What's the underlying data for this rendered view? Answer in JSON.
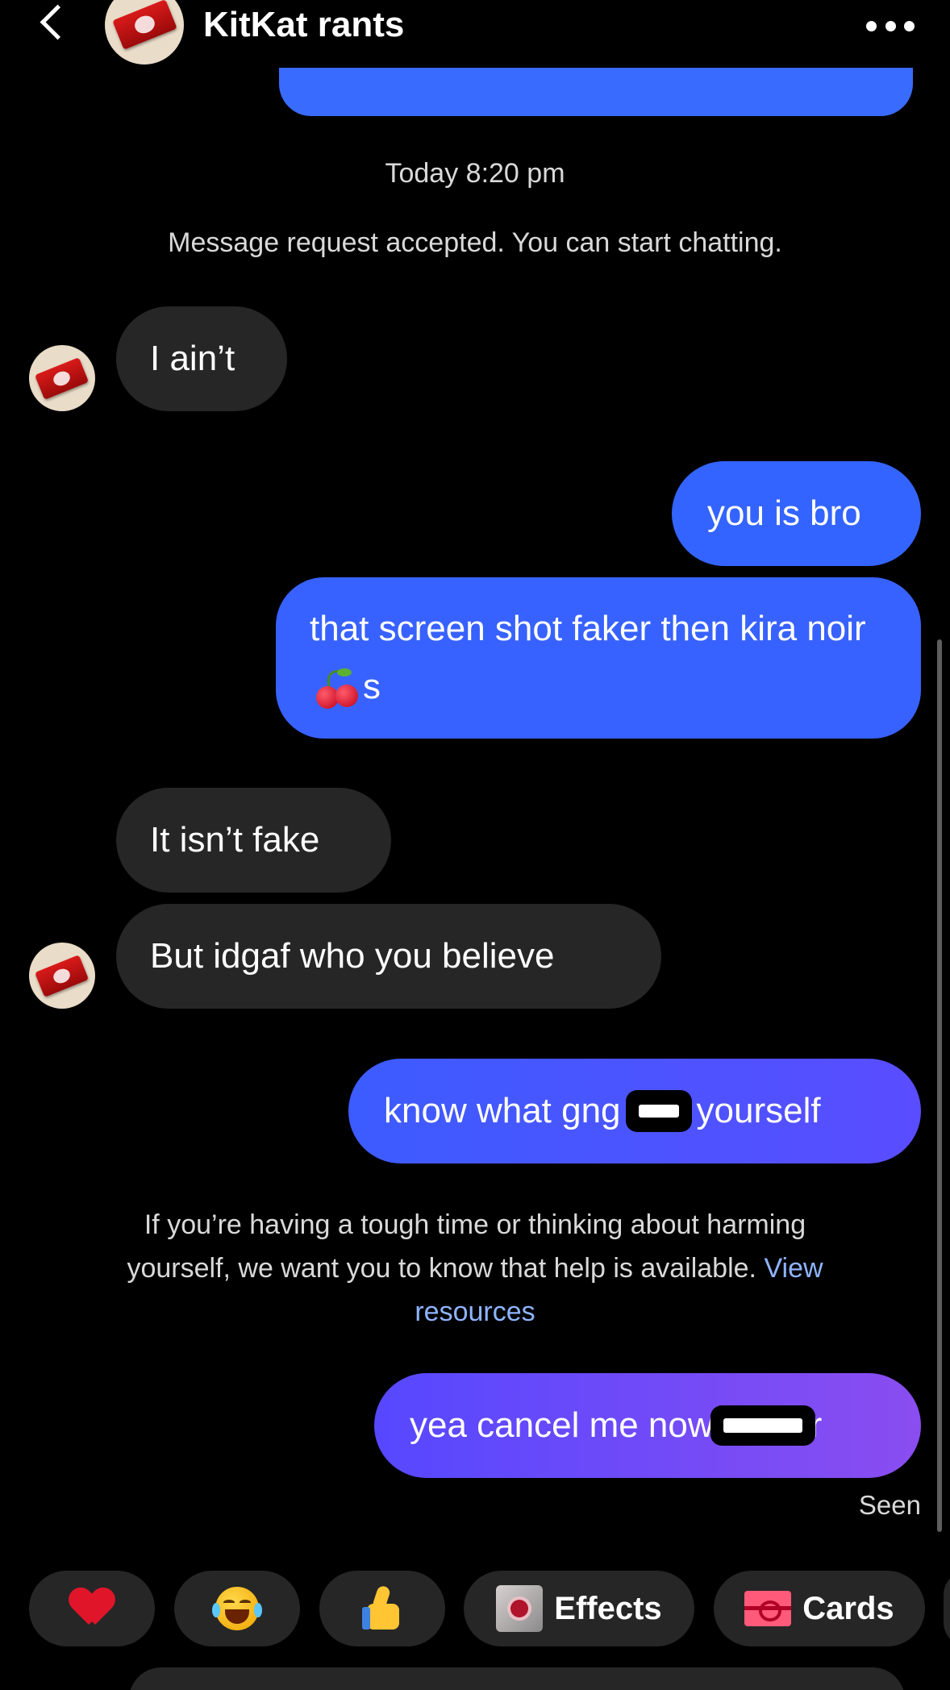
{
  "header": {
    "title": "KitKat rants"
  },
  "thread": {
    "timestamp": "Today 8:20 pm",
    "system_note": "Message request accepted. You can start chatting.",
    "messages": [
      {
        "from": "them",
        "text": "I ain’t"
      },
      {
        "from": "me",
        "text": "you is bro"
      },
      {
        "from": "me",
        "text_before": "that screen shot faker then kira noir",
        "text_after": "s"
      },
      {
        "from": "them",
        "text": "It isn’t fake"
      },
      {
        "from": "them",
        "text": "But idgaf who you believe"
      },
      {
        "from": "me",
        "text_before": "know what gng",
        "text_after": "yourself"
      },
      {
        "from": "me",
        "text_before": "yea cancel me now ",
        "text_after": "r"
      }
    ],
    "help_notice": {
      "text": "If you’re having a tough time or thinking about harming yourself, we want you to know that help is available.",
      "link": "View resources"
    },
    "seen": "Seen"
  },
  "quick_reactions": {
    "icons": [
      "heart-emoji",
      "tears-of-joy-emoji",
      "thumbs-up-emoji"
    ],
    "effects_label": "Effects",
    "cards_label": "Cards"
  },
  "colors": {
    "background": "#000000",
    "incoming_bubble": "#262626",
    "outgoing_bubble": "#3464ff",
    "outgoing_gradient_end": "#8a4df0",
    "link": "#8fb4ff"
  }
}
